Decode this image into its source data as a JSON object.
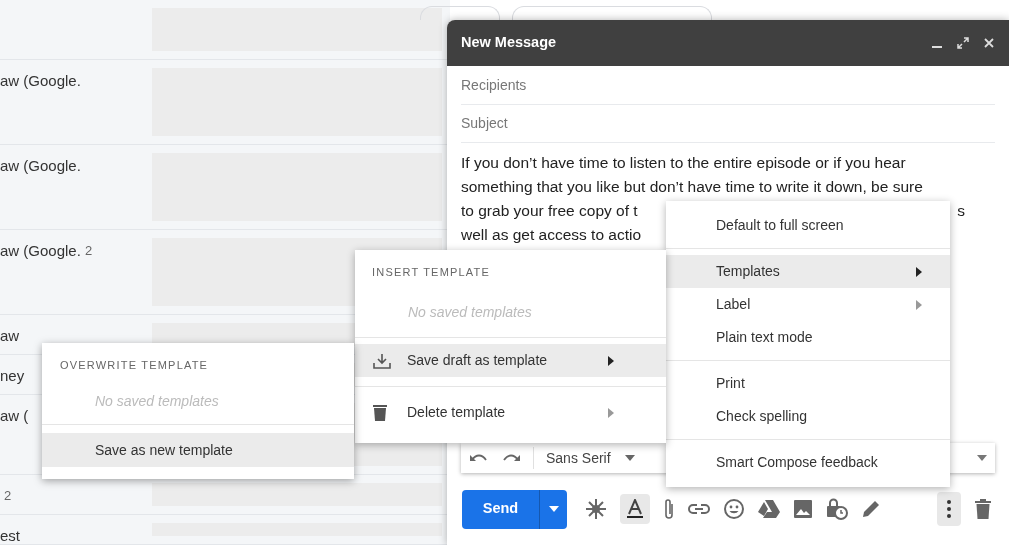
{
  "mail_list": {
    "rows": [
      {
        "kind": "blank"
      },
      {
        "kind": "message",
        "sender": "aw (Google."
      },
      {
        "kind": "message",
        "sender": "aw (Google."
      },
      {
        "kind": "message",
        "sender": "aw (Google.",
        "count": "2"
      },
      {
        "kind": "message",
        "sender": "aw"
      },
      {
        "kind": "message",
        "sender": "ney"
      },
      {
        "kind": "message",
        "sender": "aw ("
      },
      {
        "kind": "message",
        "count": "2"
      },
      {
        "kind": "message",
        "sender": "est"
      }
    ]
  },
  "compose": {
    "title": "New Message",
    "recipients": {
      "placeholder": "Recipients"
    },
    "subject": {
      "placeholder": "Subject"
    },
    "body_lines": [
      "If you don’t have time to listen to the entire episode or if you hear",
      "something that you like but don’t have time to write it down, be sure",
      "to grab your free copy of t",
      "well as get access to actio"
    ],
    "body_line_3_end": "s",
    "font": "Sans Serif",
    "send_label": "Send"
  },
  "more_options_menu": {
    "items": [
      {
        "kind": "item",
        "label": "Default to full screen",
        "selected": false,
        "submenu": false
      },
      {
        "kind": "divider"
      },
      {
        "kind": "item",
        "label": "Templates",
        "selected": true,
        "submenu": true
      },
      {
        "kind": "item",
        "label": "Label",
        "selected": false,
        "submenu": true
      },
      {
        "kind": "item",
        "label": "Plain text mode",
        "selected": false,
        "submenu": false
      },
      {
        "kind": "divider"
      },
      {
        "kind": "item",
        "label": "Print",
        "selected": false,
        "submenu": false
      },
      {
        "kind": "item",
        "label": "Check spelling",
        "selected": false,
        "submenu": false
      },
      {
        "kind": "divider"
      },
      {
        "kind": "item",
        "label": "Smart Compose feedback",
        "selected": false,
        "submenu": false
      }
    ]
  },
  "templates_menu": {
    "header": "INSERT TEMPLATE",
    "empty": "No saved templates",
    "items": [
      {
        "label": "Save draft as template",
        "selected": true
      },
      {
        "label": "Delete template",
        "selected": false
      }
    ]
  },
  "overwrite_menu": {
    "header": "OVERWRITE TEMPLATE",
    "empty": "No saved templates",
    "items": [
      {
        "label": "Save as new template",
        "selected": true
      }
    ]
  }
}
